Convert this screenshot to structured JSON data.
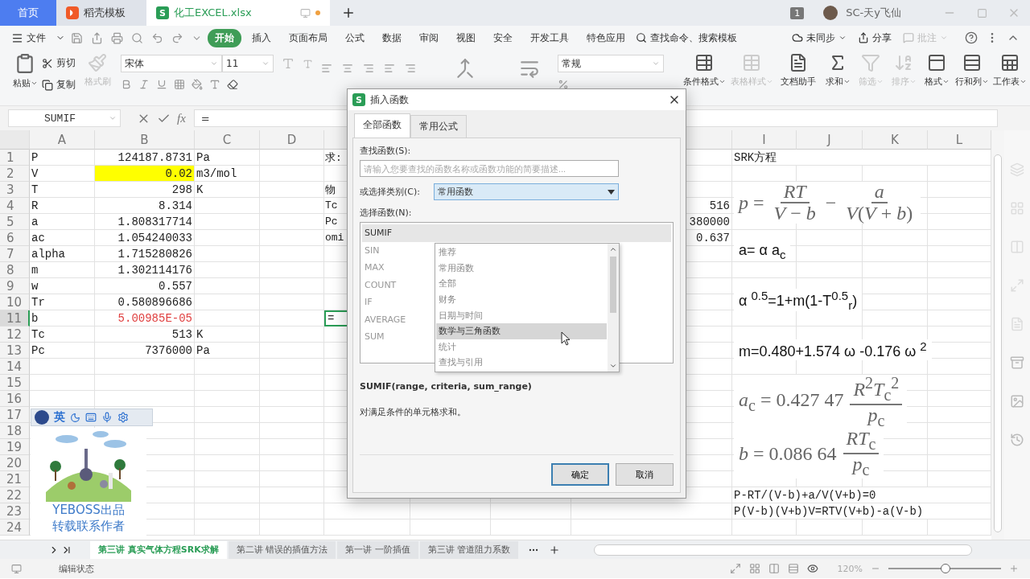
{
  "tabs": [
    {
      "label": "首页",
      "selected": false
    },
    {
      "label": "稻壳模板",
      "selected": false
    },
    {
      "label": "化工EXCEL.xlsx",
      "selected": true,
      "modified": true,
      "icon_text": "S"
    }
  ],
  "account": {
    "badge": "1",
    "name": "SC-天y飞仙"
  },
  "menu": {
    "file": "文件",
    "tabs": [
      {
        "label": "开始",
        "selected": true
      },
      {
        "label": "插入",
        "selected": false
      },
      {
        "label": "页面布局",
        "selected": false
      },
      {
        "label": "公式",
        "selected": false
      },
      {
        "label": "数据",
        "selected": false
      },
      {
        "label": "审阅",
        "selected": false
      },
      {
        "label": "视图",
        "selected": false
      },
      {
        "label": "安全",
        "selected": false
      },
      {
        "label": "开发工具",
        "selected": false
      },
      {
        "label": "特色应用",
        "selected": false
      }
    ],
    "search": "查找命令、搜索模板",
    "sync": "未同步",
    "share": "分享",
    "comment": {
      "label": "批注",
      "disabled": true
    }
  },
  "ribbon": {
    "paste": "粘贴",
    "cut": "剪切",
    "copy": "复制",
    "format_painter": {
      "label": "格式刷",
      "disabled": true
    },
    "font": "宋体",
    "font_size": "11",
    "number_format": "常规",
    "tools": [
      {
        "label": "条件格式",
        "disabled": false,
        "dropdown": true
      },
      {
        "label": "表格样式",
        "disabled": true,
        "dropdown": true
      },
      {
        "label": "文档助手",
        "disabled": false,
        "dropdown": false
      },
      {
        "label": "求和",
        "disabled": false,
        "dropdown": true
      },
      {
        "label": "筛选",
        "disabled": true,
        "dropdown": true
      },
      {
        "label": "排序",
        "disabled": true,
        "dropdown": true
      },
      {
        "label": "格式",
        "disabled": false,
        "dropdown": true
      },
      {
        "label": "行和列",
        "disabled": false,
        "dropdown": true
      },
      {
        "label": "工作表",
        "disabled": false,
        "dropdown": true
      }
    ]
  },
  "formula_bar": {
    "name_box": "SUMIF",
    "fx": "fx",
    "formula": "="
  },
  "sheet": {
    "column_headers": [
      "A",
      "B",
      "C",
      "D",
      "I",
      "J",
      "K",
      "L"
    ],
    "rows": [
      {
        "number": "1",
        "active": false,
        "a": "P",
        "b": {
          "text": "124187.8731",
          "kind": "plain"
        },
        "c": "Pa",
        "e": "求:",
        "i": "SRK方程"
      },
      {
        "number": "2",
        "active": false,
        "a": "V",
        "b": {
          "text": "0.02",
          "kind": "highlight"
        },
        "c": "m3/mol"
      },
      {
        "number": "3",
        "active": false,
        "a": "T",
        "b": {
          "text": "298",
          "kind": "plain"
        },
        "c": "K",
        "e": "物"
      },
      {
        "number": "4",
        "active": false,
        "a": "R",
        "b": {
          "text": "8.314",
          "kind": "plain"
        },
        "e": "Tc",
        "h": "516"
      },
      {
        "number": "5",
        "active": false,
        "a": "a",
        "b": {
          "text": "1.808317714",
          "kind": "plain"
        },
        "e": "Pc",
        "h": "380000"
      },
      {
        "number": "6",
        "active": false,
        "a": "ac",
        "b": {
          "text": "1.054240033",
          "kind": "plain"
        },
        "e": "omi",
        "h": "0.637"
      },
      {
        "number": "7",
        "active": false,
        "a": "alpha",
        "b": {
          "text": "1.715280826",
          "kind": "plain"
        }
      },
      {
        "number": "8",
        "active": false,
        "a": "m",
        "b": {
          "text": "1.302114176",
          "kind": "plain"
        }
      },
      {
        "number": "9",
        "active": false,
        "a": "w",
        "b": {
          "text": "0.557",
          "kind": "plain"
        }
      },
      {
        "number": "10",
        "active": false,
        "a": "Tr",
        "b": {
          "text": "0.580896686",
          "kind": "plain"
        }
      },
      {
        "number": "11",
        "active": true,
        "a": "b",
        "b": {
          "text": "5.00985E-05",
          "kind": "error"
        },
        "e": "="
      },
      {
        "number": "12",
        "active": false,
        "a": "Tc",
        "b": {
          "text": "513",
          "kind": "plain"
        },
        "c": "K"
      },
      {
        "number": "13",
        "active": false,
        "a": "Pc",
        "b": {
          "text": "7376000",
          "kind": "plain"
        },
        "c": "Pa"
      },
      {
        "number": "14",
        "active": false
      },
      {
        "number": "15",
        "active": false
      },
      {
        "number": "16",
        "active": false
      },
      {
        "number": "17",
        "active": false
      },
      {
        "number": "18",
        "active": false
      },
      {
        "number": "19",
        "active": false
      },
      {
        "number": "20",
        "active": false
      },
      {
        "number": "21",
        "active": false
      },
      {
        "number": "22",
        "active": false,
        "i": "P-RT/(V-b)+a/V(V+b)=0"
      },
      {
        "number": "23",
        "active": false,
        "i": "P(V-b)(V+b)V=RTV(V+b)-a(V-b)"
      },
      {
        "number": "24",
        "active": false
      }
    ],
    "formulas": [
      {
        "kind": "serif",
        "parts": [
          {
            "kind": "text",
            "text": "*p* ="
          },
          {
            "kind": "frac",
            "num": "*RT*",
            "den": "*V* − *b*"
          },
          {
            "kind": "text",
            "text": "−"
          },
          {
            "kind": "frac",
            "num": "*a*",
            "den": "*V*(*V* + *b*)"
          }
        ]
      },
      {
        "kind": "sans",
        "parts": [
          {
            "kind": "text",
            "text": "a= α a$_{c}$"
          }
        ]
      },
      {
        "kind": "sans",
        "parts": [
          {
            "kind": "text",
            "text": "α $^{0.5}$=1+m(1-T$^{0.5}$$_{r}$)"
          }
        ]
      },
      {
        "kind": "sans",
        "parts": [
          {
            "kind": "text",
            "text": "m=0.480+1.574 ω -0.176 ω $^{2}$"
          }
        ]
      },
      {
        "kind": "serif",
        "parts": [
          {
            "kind": "text",
            "text": "*a*$_{c}$ = 0.427 47"
          },
          {
            "kind": "frac",
            "num": "*R*$^{2}$*T*$_{c}$$^{2}$",
            "den": "*p*$_{c}$"
          }
        ]
      },
      {
        "kind": "serif",
        "parts": [
          {
            "kind": "text",
            "text": "*b* = 0.086 64"
          },
          {
            "kind": "frac",
            "num": "*RT*$_{c}$",
            "den": "*p*$_{c}$"
          }
        ]
      }
    ],
    "ime": {
      "mode": "英"
    },
    "logo": {
      "kind": "picture",
      "lines": [
        "YEBOSS出品",
        "转载联系作者"
      ]
    }
  },
  "dialog": {
    "icon_text": "S",
    "title": "插入函数",
    "tabs": [
      {
        "label": "全部函数",
        "selected": true
      },
      {
        "label": "常用公式",
        "selected": false
      }
    ],
    "search_label": "查找函数(S):",
    "search_placeholder": "请输入您要查找的函数名称或函数功能的简要描述...",
    "category_label": "或选择类别(C):",
    "category": "常用函数",
    "category_options": [
      {
        "label": "推荐",
        "selected": false
      },
      {
        "label": "常用函数",
        "selected": false
      },
      {
        "label": "全部",
        "selected": false
      },
      {
        "label": "财务",
        "selected": false
      },
      {
        "label": "日期与时间",
        "selected": false
      },
      {
        "label": "数学与三角函数",
        "selected": true
      },
      {
        "label": "统计",
        "selected": false
      },
      {
        "label": "查找与引用",
        "selected": false
      }
    ],
    "function_label": "选择函数(N):",
    "functions": [
      {
        "label": "SUMIF",
        "selected": true
      },
      {
        "label": "SIN",
        "selected": false
      },
      {
        "label": "MAX",
        "selected": false
      },
      {
        "label": "COUNT",
        "selected": false
      },
      {
        "label": "IF",
        "selected": false
      },
      {
        "label": "AVERAGE",
        "selected": false
      },
      {
        "label": "SUM",
        "selected": false
      }
    ],
    "signature": "SUMIF(range, criteria, sum_range)",
    "description": "对满足条件的单元格求和。",
    "buttons": [
      {
        "label": "确定",
        "kind": "primary"
      },
      {
        "label": "取消",
        "kind": "secondary"
      }
    ]
  },
  "sheet_tabs": [
    {
      "label": "第三讲 真实气体方程SRK求解",
      "selected": true
    },
    {
      "label": "第二讲 错误的插值方法",
      "selected": false
    },
    {
      "label": "第一讲 一阶插值",
      "selected": false
    },
    {
      "label": "第三讲 管道阻力系数",
      "selected": false
    }
  ],
  "status_bar": {
    "mode": "编辑状态",
    "zoom": "120%",
    "level": 0.51
  }
}
